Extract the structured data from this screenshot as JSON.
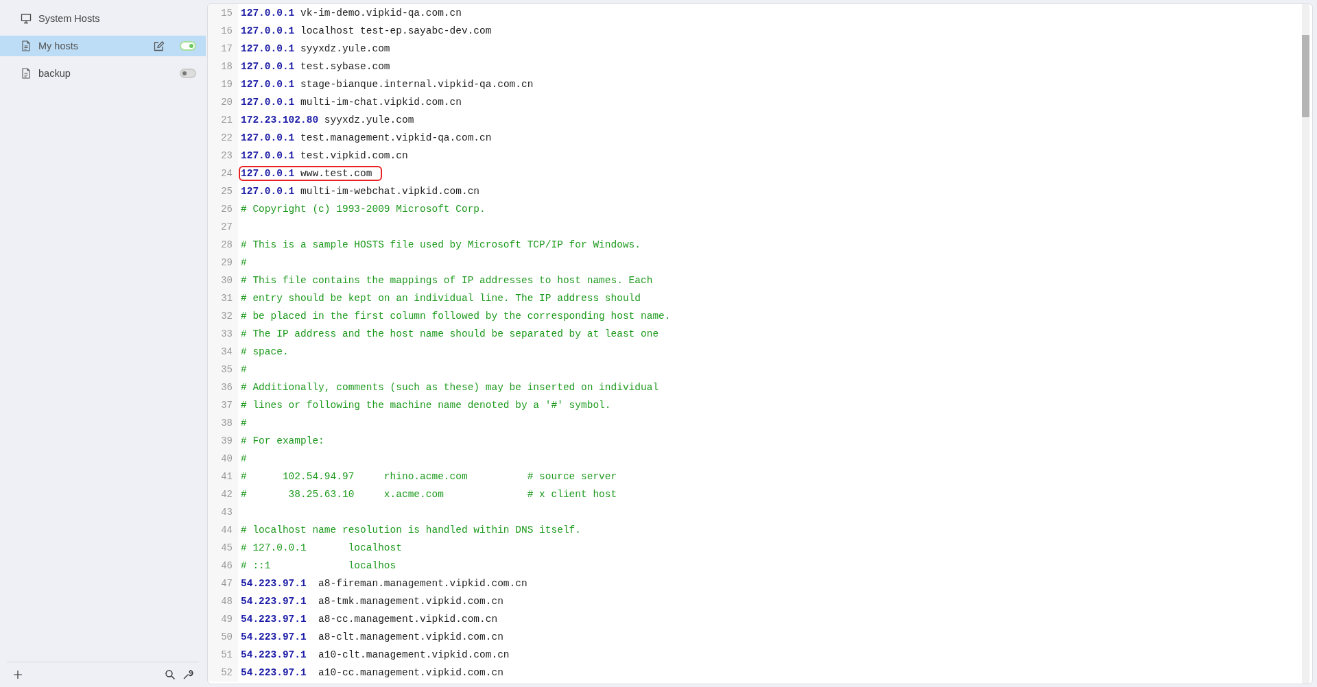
{
  "sidebar": {
    "items": [
      {
        "kind": "system",
        "label": "System Hosts",
        "selected": false
      },
      {
        "kind": "file",
        "label": "My hosts",
        "selected": true,
        "on": true
      },
      {
        "kind": "file",
        "label": "backup",
        "selected": false,
        "on": false
      }
    ]
  },
  "editor": {
    "lines": [
      {
        "number": "15",
        "kind": "host",
        "ip": "127.0.0.1",
        "host": "vk-im-demo.vipkid-qa.com.cn",
        "boxed": false
      },
      {
        "number": "16",
        "kind": "host",
        "ip": "127.0.0.1",
        "host": "localhost test-ep.sayabc-dev.com",
        "boxed": false
      },
      {
        "number": "17",
        "kind": "host",
        "ip": "127.0.0.1",
        "host": "syyxdz.yule.com",
        "boxed": false
      },
      {
        "number": "18",
        "kind": "host",
        "ip": "127.0.0.1",
        "host": "test.sybase.com",
        "boxed": false
      },
      {
        "number": "19",
        "kind": "host",
        "ip": "127.0.0.1",
        "host": "stage-bianque.internal.vipkid-qa.com.cn",
        "boxed": false
      },
      {
        "number": "20",
        "kind": "host",
        "ip": "127.0.0.1",
        "host": "multi-im-chat.vipkid.com.cn",
        "boxed": false
      },
      {
        "number": "21",
        "kind": "host",
        "ip": "172.23.102.80",
        "host": "syyxdz.yule.com",
        "boxed": false
      },
      {
        "number": "22",
        "kind": "host",
        "ip": "127.0.0.1",
        "host": "test.management.vipkid-qa.com.cn",
        "boxed": false
      },
      {
        "number": "23",
        "kind": "host",
        "ip": "127.0.0.1",
        "host": "test.vipkid.com.cn",
        "boxed": false
      },
      {
        "number": "24",
        "kind": "host",
        "ip": "127.0.0.1",
        "host": "www.test.com",
        "boxed": true
      },
      {
        "number": "25",
        "kind": "host",
        "ip": "127.0.0.1",
        "host": "multi-im-webchat.vipkid.com.cn",
        "boxed": false
      },
      {
        "number": "26",
        "kind": "comment",
        "text": "# Copyright (c) 1993-2009 Microsoft Corp.",
        "boxed": false
      },
      {
        "number": "27",
        "kind": "blank",
        "boxed": false
      },
      {
        "number": "28",
        "kind": "comment",
        "text": "# This is a sample HOSTS file used by Microsoft TCP/IP for Windows.",
        "boxed": false
      },
      {
        "number": "29",
        "kind": "comment",
        "text": "#",
        "boxed": false
      },
      {
        "number": "30",
        "kind": "comment",
        "text": "# This file contains the mappings of IP addresses to host names. Each",
        "boxed": false
      },
      {
        "number": "31",
        "kind": "comment",
        "text": "# entry should be kept on an individual line. The IP address should",
        "boxed": false
      },
      {
        "number": "32",
        "kind": "comment",
        "text": "# be placed in the first column followed by the corresponding host name.",
        "boxed": false
      },
      {
        "number": "33",
        "kind": "comment",
        "text": "# The IP address and the host name should be separated by at least one",
        "boxed": false
      },
      {
        "number": "34",
        "kind": "comment",
        "text": "# space.",
        "boxed": false
      },
      {
        "number": "35",
        "kind": "comment",
        "text": "#",
        "boxed": false
      },
      {
        "number": "36",
        "kind": "comment",
        "text": "# Additionally, comments (such as these) may be inserted on individual",
        "boxed": false
      },
      {
        "number": "37",
        "kind": "comment",
        "text": "# lines or following the machine name denoted by a '#' symbol.",
        "boxed": false
      },
      {
        "number": "38",
        "kind": "comment",
        "text": "#",
        "boxed": false
      },
      {
        "number": "39",
        "kind": "comment",
        "text": "# For example:",
        "boxed": false
      },
      {
        "number": "40",
        "kind": "comment",
        "text": "#",
        "boxed": false
      },
      {
        "number": "41",
        "kind": "comment",
        "text": "#      102.54.94.97     rhino.acme.com          # source server",
        "boxed": false
      },
      {
        "number": "42",
        "kind": "comment",
        "text": "#       38.25.63.10     x.acme.com              # x client host",
        "boxed": false
      },
      {
        "number": "43",
        "kind": "blank",
        "boxed": false
      },
      {
        "number": "44",
        "kind": "comment",
        "text": "# localhost name resolution is handled within DNS itself.",
        "boxed": false
      },
      {
        "number": "45",
        "kind": "comment",
        "text": "# 127.0.0.1       localhost",
        "boxed": false
      },
      {
        "number": "46",
        "kind": "comment",
        "text": "# ::1             localhos",
        "boxed": false
      },
      {
        "number": "47",
        "kind": "host",
        "ip": "54.223.97.1",
        "host": " a8-fireman.management.vipkid.com.cn",
        "boxed": false
      },
      {
        "number": "48",
        "kind": "host",
        "ip": "54.223.97.1",
        "host": " a8-tmk.management.vipkid.com.cn",
        "boxed": false
      },
      {
        "number": "49",
        "kind": "host",
        "ip": "54.223.97.1",
        "host": " a8-cc.management.vipkid.com.cn",
        "boxed": false
      },
      {
        "number": "50",
        "kind": "host",
        "ip": "54.223.97.1",
        "host": " a8-clt.management.vipkid.com.cn",
        "boxed": false
      },
      {
        "number": "51",
        "kind": "host",
        "ip": "54.223.97.1",
        "host": " a10-clt.management.vipkid.com.cn",
        "boxed": false
      },
      {
        "number": "52",
        "kind": "host",
        "ip": "54.223.97.1",
        "host": " a10-cc.management.vipkid.com.cn",
        "boxed": false
      }
    ]
  }
}
